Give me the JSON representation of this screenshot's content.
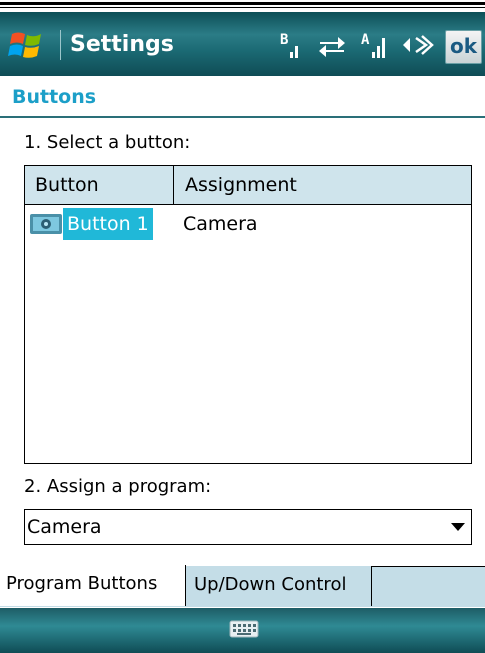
{
  "app": {
    "title": "Settings",
    "ok_label": "ok"
  },
  "section": {
    "title": "Buttons"
  },
  "step1": {
    "label": "1. Select a button:"
  },
  "list": {
    "columns": [
      "Button",
      "Assignment"
    ],
    "rows": [
      {
        "button": "Button 1",
        "assignment": "Camera"
      }
    ]
  },
  "step2": {
    "label": "2. Assign a program:",
    "selected_value": "Camera"
  },
  "tabs": [
    {
      "label": "Program Buttons",
      "active": true
    },
    {
      "label": "Up/Down Control",
      "active": false
    }
  ],
  "colors": {
    "title_bar": "#1b6a74",
    "section_title": "#1c9fc8",
    "selection": "#20b8d8",
    "list_header": "#cfe4ec"
  },
  "icons": [
    "windows-start-icon",
    "bluetooth-signal-icon",
    "data-connection-icon",
    "signal-strength-icon",
    "volume-icon",
    "keyboard-icon",
    "button-icon"
  ]
}
